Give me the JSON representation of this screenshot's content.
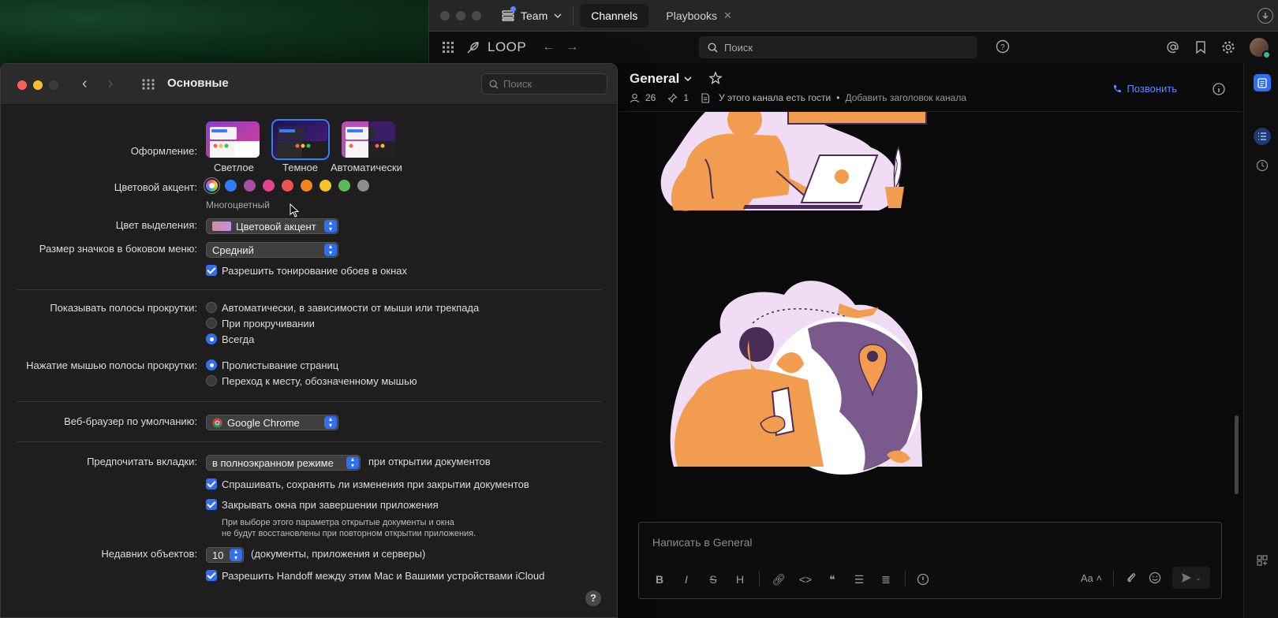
{
  "chat": {
    "team_label": "Team",
    "tabs": [
      {
        "label": "Channels"
      },
      {
        "label": "Playbooks"
      }
    ],
    "logo_text": "LOOP",
    "search_placeholder": "Поиск",
    "channel": {
      "name": "General",
      "members_count": "26",
      "pinned_count": "1",
      "guests_notice": "У этого канала есть гости",
      "add_header": "Добавить заголовок канала",
      "call_label": "Позвонить"
    },
    "composer_placeholder": "Написать в General",
    "format_buttons": [
      "B",
      "I",
      "S",
      "H"
    ],
    "text_size_label": "Aa"
  },
  "settings": {
    "window_title": "Основные",
    "search_placeholder": "Поиск",
    "appearance": {
      "label": "Оформление:",
      "options": [
        "Светлое",
        "Темное",
        "Автоматически"
      ],
      "selected": "Темное"
    },
    "accent": {
      "label": "Цветовой акцент:",
      "selected_name": "Многоцветный",
      "colors": [
        "#2f7bff",
        "#a550a7",
        "#e8418d",
        "#ef5350",
        "#f5841f",
        "#f7c325",
        "#5cb85c",
        "#8c8c8c"
      ]
    },
    "highlight": {
      "label": "Цвет выделения:",
      "value": "Цветовой акцент"
    },
    "sidebar_icon_size": {
      "label": "Размер значков в боковом меню:",
      "value": "Средний"
    },
    "wallpaper_tinting": "Разрешить тонирование обоев в окнах",
    "scrollbars": {
      "label": "Показывать полосы прокрутки:",
      "options": [
        "Автоматически, в зависимости от мыши или трекпада",
        "При прокручивании",
        "Всегда"
      ],
      "selected_index": 2
    },
    "scroll_click": {
      "label": "Нажатие мышью полосы прокрутки:",
      "options": [
        "Пролистывание страниц",
        "Переход к месту, обозначенному мышью"
      ],
      "selected_index": 0
    },
    "browser": {
      "label": "Веб-браузер по умолчанию:",
      "value": "Google Chrome"
    },
    "tabs_pref": {
      "label": "Предпочитать вкладки:",
      "value": "в полноэкранном режиме",
      "suffix": "при открытии документов"
    },
    "ask_save": "Спрашивать, сохранять ли изменения при закрытии документов",
    "close_windows": "Закрывать окна при завершении приложения",
    "close_windows_note_1": "При выборе этого параметра открытые документы и окна",
    "close_windows_note_2": "не будут восстановлены при повторном открытии приложения.",
    "recent_items": {
      "label": "Недавних объектов:",
      "value": "10",
      "suffix": "(документы, приложения и серверы)"
    },
    "handoff": "Разрешить Handoff между этим Mac и Вашими устройствами iCloud",
    "help": "?"
  }
}
